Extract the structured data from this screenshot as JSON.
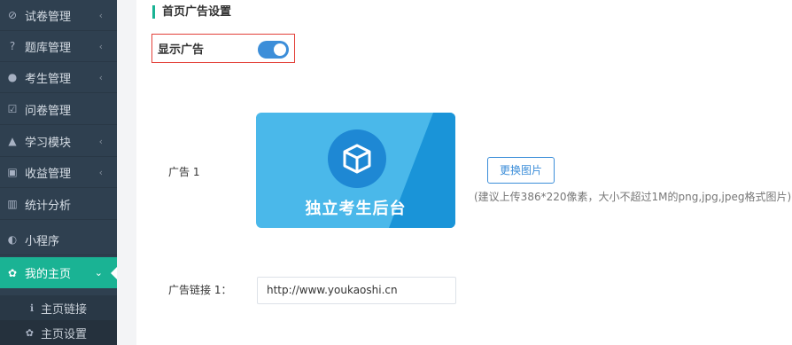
{
  "sidebar": {
    "items": [
      {
        "icon": "check-circle-icon",
        "glyph": "⊘",
        "label": "试卷管理",
        "chevron": "‹"
      },
      {
        "icon": "question-circle-icon",
        "glyph": "?",
        "label": "题库管理",
        "chevron": "‹"
      },
      {
        "icon": "user-icon",
        "glyph": "●",
        "label": "考生管理",
        "chevron": "‹"
      },
      {
        "icon": "checkbox-icon",
        "glyph": "☑",
        "label": "问卷管理",
        "chevron": ""
      },
      {
        "icon": "graduation-cap-icon",
        "glyph": "▲",
        "label": "学习模块",
        "chevron": "‹"
      },
      {
        "icon": "money-icon",
        "glyph": "▣",
        "label": "收益管理",
        "chevron": "‹"
      },
      {
        "icon": "bar-chart-icon",
        "glyph": "▥",
        "label": "统计分析",
        "chevron": ""
      },
      {
        "icon": "wechat-icon",
        "glyph": "◐",
        "label": "小程序",
        "chevron": ""
      },
      {
        "icon": "leaf-icon",
        "glyph": "✿",
        "label": "我的主页",
        "chevron": "⌄"
      }
    ],
    "sub_items": [
      {
        "icon": "info-icon",
        "glyph": "ℹ",
        "label": "主页链接"
      },
      {
        "icon": "leaf-icon",
        "glyph": "✿",
        "label": "主页设置"
      }
    ]
  },
  "main": {
    "section_title": "首页广告设置",
    "toggle_label": "显示广告",
    "toggle_on": true,
    "ad_label": "广告 1",
    "ad_image_caption": "独立考生后台",
    "change_button": "更换图片",
    "hint": "(建议上传386*220像素，大小不超过1M的png,jpg,jpeg格式图片)",
    "link_label": "广告链接 1：",
    "link_value": "http://www.youkaoshi.cn"
  },
  "colors": {
    "sidebar_bg": "#2f4050",
    "active": "#1ab394",
    "accent": "#3c8ed9",
    "highlight_border": "#e3413a"
  }
}
